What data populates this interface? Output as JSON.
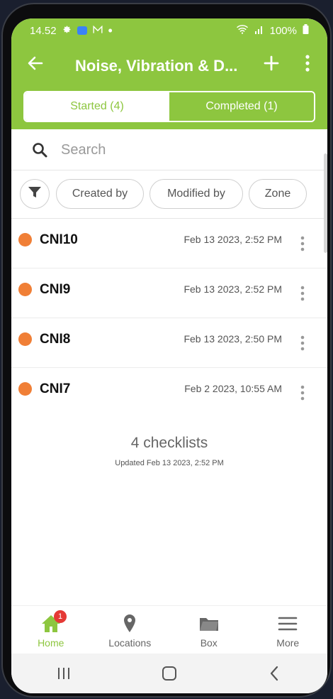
{
  "status": {
    "time": "14.52",
    "battery": "100%"
  },
  "appbar": {
    "title": "Noise, Vibration & D..."
  },
  "tabs": [
    {
      "label": "Started (4)",
      "active": true
    },
    {
      "label": "Completed (1)",
      "active": false
    }
  ],
  "search": {
    "placeholder": "Search"
  },
  "filters": {
    "chips": [
      "Created by",
      "Modified by",
      "Zone"
    ]
  },
  "checklists": [
    {
      "name": "CNI10",
      "date": "Feb 13 2023, 2:52 PM"
    },
    {
      "name": "CNI9",
      "date": "Feb 13 2023, 2:52 PM"
    },
    {
      "name": "CNI8",
      "date": "Feb 13 2023, 2:50 PM"
    },
    {
      "name": "CNI7",
      "date": "Feb 2 2023, 10:55 AM"
    }
  ],
  "summary": {
    "count": "4 checklists",
    "updated": "Updated Feb 13 2023, 2:52 PM"
  },
  "bottom_nav": [
    {
      "label": "Home",
      "icon": "home-icon",
      "badge": "1"
    },
    {
      "label": "Locations",
      "icon": "location-pin-icon"
    },
    {
      "label": "Box",
      "icon": "folder-icon"
    },
    {
      "label": "More",
      "icon": "menu-icon"
    }
  ],
  "colors": {
    "primary": "#8dc63f",
    "status_dot": "#f07f36",
    "badge": "#e53935"
  }
}
